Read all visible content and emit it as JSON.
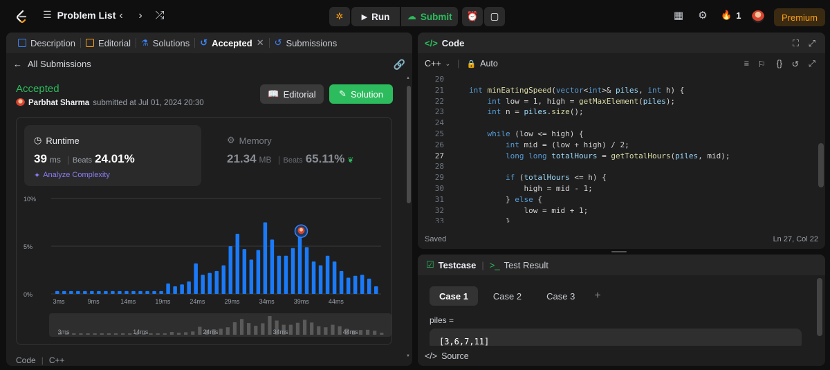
{
  "topbar": {
    "title": "Problem List",
    "run_label": "Run",
    "submit_label": "Submit",
    "streak": "1",
    "premium_label": "Premium"
  },
  "left_tabs": [
    {
      "label": "Description"
    },
    {
      "label": "Editorial"
    },
    {
      "label": "Solutions"
    },
    {
      "label": "Accepted"
    },
    {
      "label": "Submissions"
    }
  ],
  "submission": {
    "back_label": "All Submissions",
    "status": "Accepted",
    "user": "Parbhat Sharma",
    "submitted_text": "submitted at Jul 01, 2024 20:30",
    "editorial_btn": "Editorial",
    "solution_btn": "Solution"
  },
  "runtime": {
    "title": "Runtime",
    "value": "39",
    "unit": "ms",
    "beats_label": "Beats",
    "beats": "24.01%",
    "analyze": "Analyze Complexity"
  },
  "memory": {
    "title": "Memory",
    "value": "21.34",
    "unit": "MB",
    "beats_label": "Beats",
    "beats": "65.11%"
  },
  "chart_data": {
    "type": "bar",
    "y_ticks": [
      "10%",
      "5%",
      "0%"
    ],
    "x_ticks": [
      "3ms",
      "9ms",
      "14ms",
      "19ms",
      "24ms",
      "29ms",
      "34ms",
      "39ms",
      "44ms"
    ],
    "ylim": [
      0,
      10
    ],
    "values": [
      0.3,
      0.3,
      0.3,
      0.3,
      0.3,
      0.3,
      0.3,
      0.3,
      0.3,
      0.3,
      0.3,
      0.3,
      0.3,
      0.3,
      0.3,
      0.3,
      1.1,
      0.8,
      1.0,
      1.3,
      3.2,
      2.0,
      2.2,
      2.4,
      3.0,
      5.0,
      6.3,
      4.7,
      3.6,
      4.6,
      7.5,
      5.7,
      4.0,
      4.0,
      4.8,
      6.0,
      4.9,
      3.4,
      3.0,
      4.0,
      3.4,
      2.4,
      1.7,
      1.9,
      2.0,
      1.6,
      0.8
    ],
    "highlight_value": 6.0,
    "mini_ticks": [
      "3ms",
      "14ms",
      "24ms",
      "34ms",
      "44ms"
    ]
  },
  "bottom": {
    "label": "Code",
    "lang": "C++"
  },
  "code": {
    "title": "Code",
    "lang": "C++",
    "mode": "Auto",
    "saved": "Saved",
    "position": "Ln 27, Col 22",
    "lines": [
      {
        "n": "20",
        "t": ""
      },
      {
        "n": "21",
        "t": "int minEatingSpeed(vector<int>& piles, int h) {"
      },
      {
        "n": "22",
        "t": "    int low = 1, high = getMaxElement(piles);"
      },
      {
        "n": "23",
        "t": "    int n = piles.size();"
      },
      {
        "n": "24",
        "t": ""
      },
      {
        "n": "25",
        "t": "    while (low <= high) {"
      },
      {
        "n": "26",
        "t": "        int mid = (low + high) / 2;"
      },
      {
        "n": "27",
        "t": "        long long totalHours = getTotalHours(piles, mid);"
      },
      {
        "n": "28",
        "t": ""
      },
      {
        "n": "29",
        "t": "        if (totalHours <= h) {"
      },
      {
        "n": "30",
        "t": "            high = mid - 1;"
      },
      {
        "n": "31",
        "t": "        } else {"
      },
      {
        "n": "32",
        "t": "            low = mid + 1;"
      },
      {
        "n": "33",
        "t": "        }"
      }
    ]
  },
  "test": {
    "tab1": "Testcase",
    "tab2": "Test Result",
    "cases": [
      "Case 1",
      "Case 2",
      "Case 3"
    ],
    "param": "piles =",
    "value": "[3,6,7,11]",
    "source": "Source"
  }
}
